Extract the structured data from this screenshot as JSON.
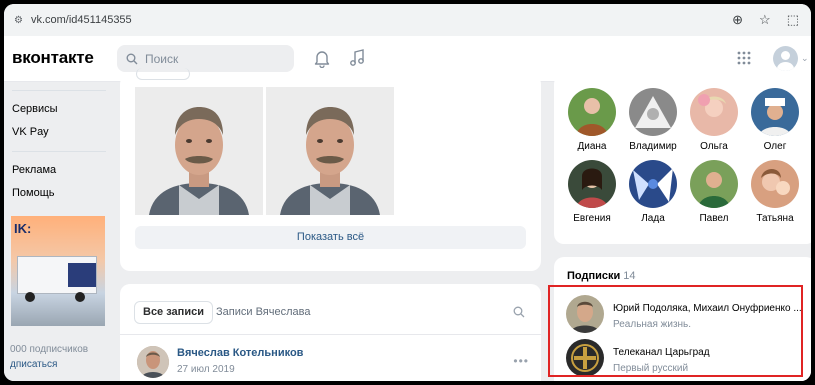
{
  "browser": {
    "url": "vk.com/id451145355"
  },
  "header": {
    "logo": "вконтакте",
    "search_placeholder": "Поиск"
  },
  "left_nav": {
    "items": [
      "Сервисы",
      "VK Pay",
      "Реклама",
      "Помощь"
    ],
    "ad": {
      "brand": "IK:",
      "subscribers": "000 подписчиков",
      "subscribe_link": "дписаться"
    }
  },
  "photos": {
    "show_all_label": "Показать всё"
  },
  "wall": {
    "tabs": [
      "Все записи",
      "Записи Вячеслава"
    ],
    "post": {
      "author": "Вячеслав Котельников",
      "date": "27 июл 2019"
    }
  },
  "friends": [
    {
      "name": "Диана",
      "color": "#6a9a4a"
    },
    {
      "name": "Владимир",
      "color": "#8a8a8a"
    },
    {
      "name": "Ольга",
      "color": "#e8b8a8"
    },
    {
      "name": "Олег",
      "color": "#3a6a9a"
    },
    {
      "name": "Евгения",
      "color": "#3a4a3a"
    },
    {
      "name": "Лада",
      "color": "#2a4a8a"
    },
    {
      "name": "Павел",
      "color": "#7aa05a"
    },
    {
      "name": "Татьяна",
      "color": "#d8a080"
    }
  ],
  "subscriptions": {
    "title": "Подписки",
    "count": "14",
    "items": [
      {
        "name": "Юрий Подоляка, Михаил Онуфриенко ...",
        "description": "Реальная жизнь.",
        "icon": "person-avatar"
      },
      {
        "name": "Телеканал Царьград",
        "description": "Первый русский",
        "icon": "tsargrad-logo"
      }
    ]
  },
  "colors": {
    "accent": "#2a5885",
    "highlight": "#e02424"
  }
}
